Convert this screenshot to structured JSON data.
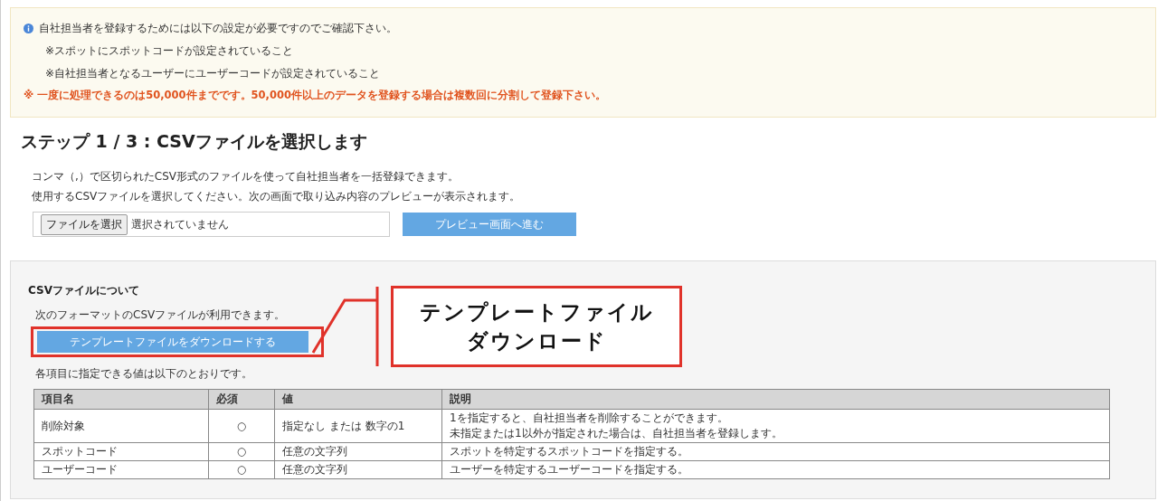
{
  "notice": {
    "intro": "自社担当者を登録するためには以下の設定が必要ですのでご確認下さい。",
    "requirements": [
      "※スポットにスポットコードが設定されていること",
      "※自社担当者となるユーザーにユーザーコードが設定されていること"
    ],
    "warning": "※ 一度に処理できるのは50,000件までです。50,000件以上のデータを登録する場合は複数回に分割して登録下さい。"
  },
  "step": {
    "title": "ステップ 1 / 3 : CSVファイルを選択します",
    "description": [
      "コンマ（,）で区切られたCSV形式のファイルを使って自社担当者を一括登録できます。",
      "使用するCSVファイルを選択してください。次の画面で取り込み内容のプレビューが表示されます。"
    ],
    "file_button": "ファイルを選択",
    "file_status": "選択されていません",
    "next_button": "プレビュー画面へ進む"
  },
  "csv_info": {
    "title": "CSVファイルについて",
    "format_note": "次のフォーマットのCSVファイルが利用できます。",
    "download_button": "テンプレートファイルをダウンロードする",
    "values_note": "各項目に指定できる値は以下のとおりです。",
    "table": {
      "columns": [
        "項目名",
        "必須",
        "値",
        "説明"
      ],
      "rows": [
        {
          "name": "削除対象",
          "required": "○",
          "value": "指定なし または 数字の1",
          "description": [
            "1を指定すると、自社担当者を削除することができます。",
            "未指定または1以外が指定された場合は、自社担当者を登録します。"
          ]
        },
        {
          "name": "スポットコード",
          "required": "○",
          "value": "任意の文字列",
          "description": [
            "スポットを特定するスポットコードを指定する。"
          ]
        },
        {
          "name": "ユーザーコード",
          "required": "○",
          "value": "任意の文字列",
          "description": [
            "ユーザーを特定するユーザーコードを指定する。"
          ]
        }
      ]
    }
  },
  "callout": {
    "lines": [
      "テンプレートファイル",
      "ダウンロード"
    ]
  }
}
